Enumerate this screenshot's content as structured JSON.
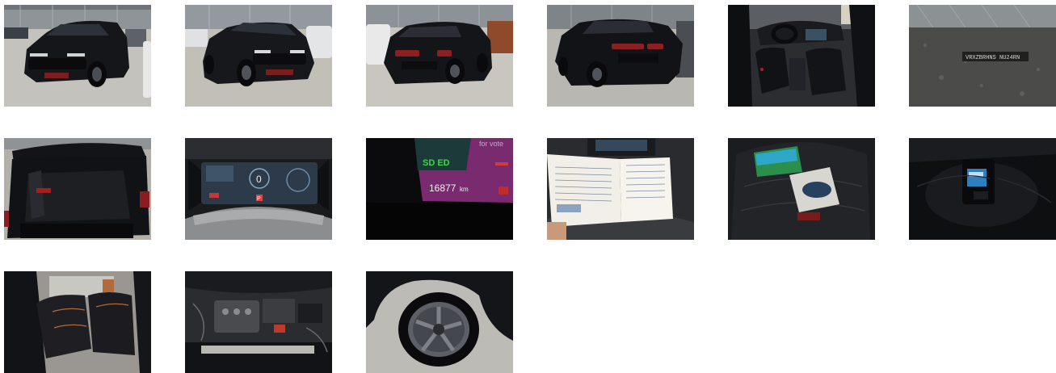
{
  "gallery": {
    "photos": [
      {
        "subject": "vehicle front three-quarter view"
      },
      {
        "subject": "vehicle front view"
      },
      {
        "subject": "vehicle rear three-quarter view"
      },
      {
        "subject": "vehicle rear three-quarter view (left)"
      },
      {
        "subject": "interior front seats"
      },
      {
        "subject": "vin plate"
      },
      {
        "subject": "open trunk"
      },
      {
        "subject": "instrument cluster"
      },
      {
        "subject": "odometer display"
      },
      {
        "subject": "service booklet"
      },
      {
        "subject": "owner manuals on seat"
      },
      {
        "subject": "spare wheel well"
      },
      {
        "subject": "rear seats"
      },
      {
        "subject": "engine bay"
      },
      {
        "subject": "wheel and tire"
      }
    ],
    "visible_text": {
      "vin_plate": "VRXZBRHNS NU24RN",
      "cluster_speed": "0",
      "cluster_gear": "P",
      "odometer_mode": "SD ED",
      "odometer_reading": "16877",
      "odometer_unit": "km",
      "screen_text": "for vote"
    }
  },
  "colors": {
    "background": "#ffffff",
    "car_body": "#15161a",
    "floor": "#bdbbb5",
    "cluster_screen": "#2d3a4a",
    "odometer_green": "#38d84a",
    "odometer_bg": "#7a2a6e"
  }
}
